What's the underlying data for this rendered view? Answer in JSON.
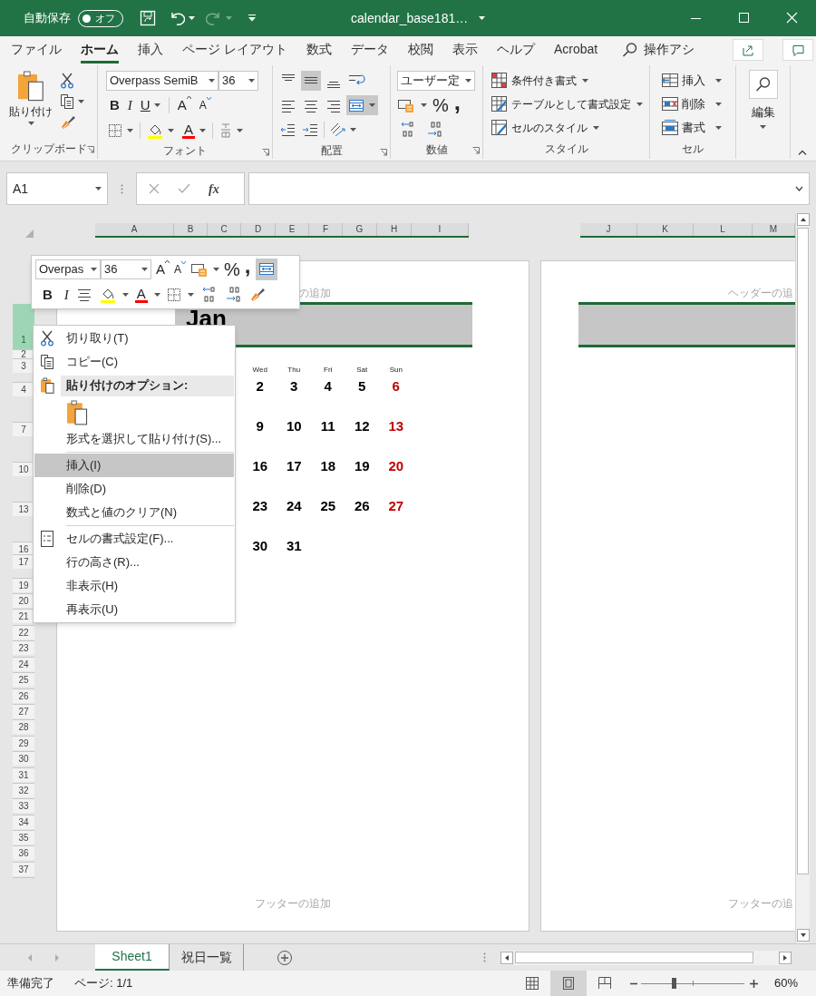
{
  "title_bar": {
    "autosave_label": "自動保存",
    "autosave_toggle": {
      "label": "オフ",
      "on": false
    },
    "redo": {
      "disabled": true
    },
    "document_title": "calendar_base181…"
  },
  "ribbon_tabs": [
    {
      "label": "ファイル",
      "selected": false
    },
    {
      "label": "ホーム",
      "selected": true
    },
    {
      "label": "挿入",
      "selected": false
    },
    {
      "label": "ページ レイアウト",
      "selected": false
    },
    {
      "label": "数式",
      "selected": false
    },
    {
      "label": "データ",
      "selected": false
    },
    {
      "label": "校閲",
      "selected": false
    },
    {
      "label": "表示",
      "selected": false
    },
    {
      "label": "ヘルプ",
      "selected": false
    },
    {
      "label": "Acrobat",
      "selected": false
    }
  ],
  "tell_me": "操作アシ",
  "ribbon": {
    "clipboard": {
      "paste": "貼り付け",
      "label": "クリップボード"
    },
    "font": {
      "font_name": "Overpass SemiB",
      "font_size": "36",
      "bold": "B",
      "italic": "I",
      "underline": "U",
      "grow": "A",
      "shrink": "A",
      "font_color": "A",
      "label": "フォント"
    },
    "alignment": {
      "middle_align_on": true,
      "merge_on": true,
      "label": "配置"
    },
    "number": {
      "format": "ユーザー定",
      "percent": "%",
      "comma": ",",
      "label": "数値"
    },
    "styles": {
      "items": [
        "条件付き書式",
        "テーブルとして書式設定",
        "セルのスタイル"
      ],
      "label": "スタイル"
    },
    "cells": {
      "items": [
        "挿入",
        "削除",
        "書式"
      ],
      "label": "セル"
    },
    "editing": {
      "label": "編集"
    }
  },
  "formula_bar": {
    "name_box": "A1",
    "function_label": "fx"
  },
  "column_headers": {
    "page_1": [
      "A",
      "B",
      "C",
      "D",
      "E",
      "F",
      "G",
      "H",
      "I"
    ],
    "page_2": [
      "J",
      "K",
      "L",
      "M"
    ]
  },
  "row_headers": [
    {
      "label": "1",
      "selected": true
    },
    {
      "label": "2",
      "selected": false
    },
    {
      "label": "3",
      "selected": false
    },
    {
      "label": "4",
      "selected": false
    },
    {
      "label": "7",
      "selected": false
    },
    {
      "label": "10",
      "selected": false
    },
    {
      "label": "13",
      "selected": false
    },
    {
      "label": "16",
      "selected": false
    },
    {
      "label": "17",
      "selected": false
    },
    {
      "label": "19",
      "selected": false
    },
    {
      "label": "20",
      "selected": false
    },
    {
      "label": "21",
      "selected": false
    },
    {
      "label": "22",
      "selected": false
    },
    {
      "label": "23",
      "selected": false
    },
    {
      "label": "24",
      "selected": false
    },
    {
      "label": "25",
      "selected": false
    },
    {
      "label": "26",
      "selected": false
    },
    {
      "label": "27",
      "selected": false
    },
    {
      "label": "28",
      "selected": false
    },
    {
      "label": "29",
      "selected": false
    },
    {
      "label": "30",
      "selected": false
    },
    {
      "label": "31",
      "selected": false
    },
    {
      "label": "32",
      "selected": false
    },
    {
      "label": "33",
      "selected": false
    },
    {
      "label": "34",
      "selected": false
    },
    {
      "label": "35",
      "selected": false
    },
    {
      "label": "36",
      "selected": false
    },
    {
      "label": "37",
      "selected": false
    }
  ],
  "pages": [
    {
      "header": "の追加",
      "month": "Jan",
      "weekdays": [
        "Wed",
        "Thu",
        "Fri",
        "Sat",
        "Sun"
      ],
      "weeks": [
        [
          {
            "day": "2",
            "kind": "weekday"
          },
          {
            "day": "3",
            "kind": "weekday"
          },
          {
            "day": "4",
            "kind": "weekday"
          },
          {
            "day": "5",
            "kind": "weekday"
          },
          {
            "day": "6",
            "kind": "sunday"
          }
        ],
        [
          {
            "day": "9",
            "kind": "weekday"
          },
          {
            "day": "10",
            "kind": "weekday"
          },
          {
            "day": "11",
            "kind": "weekday"
          },
          {
            "day": "12",
            "kind": "weekday"
          },
          {
            "day": "13",
            "kind": "sunday"
          }
        ],
        [
          {
            "day": "16",
            "kind": "weekday"
          },
          {
            "day": "17",
            "kind": "weekday"
          },
          {
            "day": "18",
            "kind": "weekday"
          },
          {
            "day": "19",
            "kind": "weekday"
          },
          {
            "day": "20",
            "kind": "sunday"
          }
        ],
        [
          {
            "day": "23",
            "kind": "weekday"
          },
          {
            "day": "24",
            "kind": "weekday"
          },
          {
            "day": "25",
            "kind": "weekday"
          },
          {
            "day": "26",
            "kind": "weekday"
          },
          {
            "day": "27",
            "kind": "sunday"
          }
        ],
        [
          {
            "day": "30",
            "kind": "weekday"
          },
          {
            "day": "31",
            "kind": "weekday"
          }
        ]
      ],
      "footer": "フッターの追加"
    },
    {
      "header": "ヘッダーの追",
      "footer": "フッターの追"
    }
  ],
  "mini_toolbar": {
    "font_name": "Overpas",
    "font_size": "36",
    "grow": "A",
    "shrink": "A",
    "percent": "%",
    "comma": ",",
    "wrap_on": true,
    "bold": "B",
    "italic": "I",
    "font_color": "A"
  },
  "context_menu": [
    {
      "kind": "cut",
      "label": "切り取り(T)",
      "selected": false
    },
    {
      "kind": "copy",
      "label": "コピー(C)",
      "selected": false
    },
    {
      "kind": "paste-heading",
      "label": "貼り付けのオプション:",
      "selected": false
    },
    {
      "kind": "paste-option",
      "selected": false
    },
    {
      "kind": "plain",
      "label": "形式を選択して貼り付け(S)...",
      "selected": false
    },
    {
      "kind": "plain",
      "label": "挿入(I)",
      "selected": true,
      "separator_above": true
    },
    {
      "kind": "plain",
      "label": "削除(D)",
      "selected": false
    },
    {
      "kind": "plain",
      "label": "数式と値のクリア(N)",
      "selected": false
    },
    {
      "kind": "format-cells",
      "label": "セルの書式設定(F)...",
      "selected": false,
      "separator_above": true
    },
    {
      "kind": "plain",
      "label": "行の高さ(R)...",
      "selected": false
    },
    {
      "kind": "plain",
      "label": "非表示(H)",
      "selected": false
    },
    {
      "kind": "plain",
      "label": "再表示(U)",
      "selected": false
    }
  ],
  "sheet_tabs": [
    {
      "label": "Sheet1",
      "selected": true
    },
    {
      "label": "祝日一覧",
      "selected": false
    }
  ],
  "status_bar": {
    "ready": "準備完了",
    "page": "ページ: 1/1",
    "views": [
      {
        "kind": "normal",
        "selected": false
      },
      {
        "kind": "page-layout",
        "selected": true
      },
      {
        "kind": "page-break",
        "selected": false
      }
    ],
    "zoom": {
      "level": 0.32,
      "reading": "60%"
    }
  }
}
